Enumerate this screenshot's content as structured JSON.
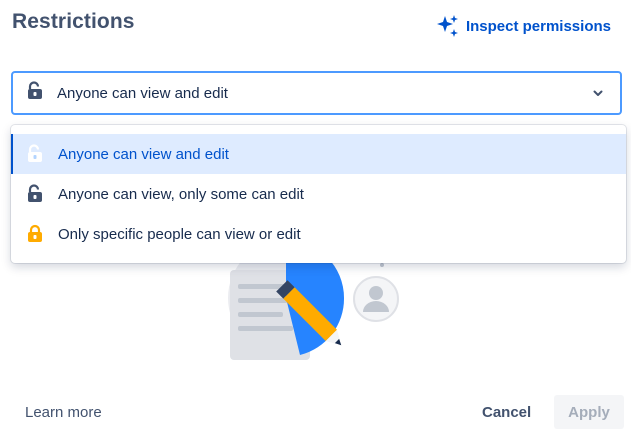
{
  "header": {
    "title": "Restrictions",
    "inspect_label": "Inspect permissions",
    "inspect_icon": "sparkle-icon"
  },
  "select": {
    "value": "Anyone can view and edit",
    "icon": "unlock-icon",
    "chevron": "chevron-down-icon"
  },
  "menu": {
    "items": [
      {
        "label": "Anyone can view and edit",
        "icon": "unlock-icon",
        "selected": true
      },
      {
        "label": "Anyone can view, only some can edit",
        "icon": "unlock-icon",
        "selected": false
      },
      {
        "label": "Only specific people can view or edit",
        "icon": "lock-icon",
        "selected": false
      }
    ]
  },
  "footer": {
    "learn_more": "Learn more",
    "cancel": "Cancel",
    "apply": "Apply"
  },
  "colors": {
    "accent": "#0052CC",
    "focus_border": "#4C9AFF",
    "selected_bg": "#DEEBFF",
    "lock_orange": "#FFAB00",
    "text": "#172B4D",
    "subtle_text": "#42526E",
    "disabled_text": "#A5ADBA"
  }
}
